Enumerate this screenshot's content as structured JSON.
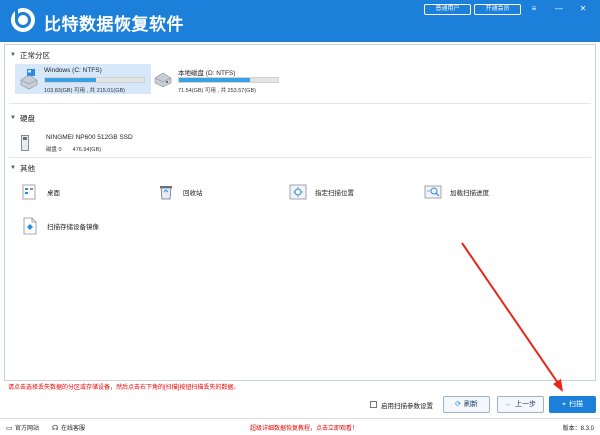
{
  "titlebar": {
    "title": "比特数据恢复软件",
    "user_button": "普通用户",
    "member_button": "开通会员"
  },
  "sections": {
    "partitions": "正常分区",
    "disks": "硬盘",
    "others": "其他"
  },
  "partitions": [
    {
      "name": "Windows (C: NTFS)",
      "size": "103.83(GB) 可用 , 共 215.01(GB)",
      "used_fraction": 0.52
    },
    {
      "name": "本地磁盘 (D: NTFS)",
      "size": "71.54(GB) 可用 , 共 253.57(GB)",
      "used_fraction": 0.72
    }
  ],
  "disk": {
    "name": "NINGMEI NP600 512GB SSD",
    "label": "磁盘 0",
    "size": "476.94(GB)"
  },
  "others": [
    {
      "label": "桌面",
      "icon": "desktop-icon"
    },
    {
      "label": "回收站",
      "icon": "recycle-bin-icon"
    },
    {
      "label": "指定扫描位置",
      "icon": "locate-icon"
    },
    {
      "label": "加载扫描进度",
      "icon": "load-progress-icon"
    },
    {
      "label": "扫描存储设备镜像",
      "icon": "image-file-icon"
    }
  ],
  "hint": "请点击选择丢失数据的分区或存储设备，然后点击右下角的[扫描]按钮扫描丢失的数据。",
  "checkbox_label": "启用扫描参数设置",
  "buttons": {
    "refresh": "刷新",
    "prev": "上一步",
    "scan": "扫描"
  },
  "footer": {
    "website": "官方网站",
    "support": "在线客服",
    "promo": "超级详细数据恢复教程，点击立即观看！",
    "version": "版本：8.3.0"
  },
  "colors": {
    "accent": "#1c7fd9",
    "warning": "#e60000",
    "bar_fill": "#3aa0e4"
  }
}
